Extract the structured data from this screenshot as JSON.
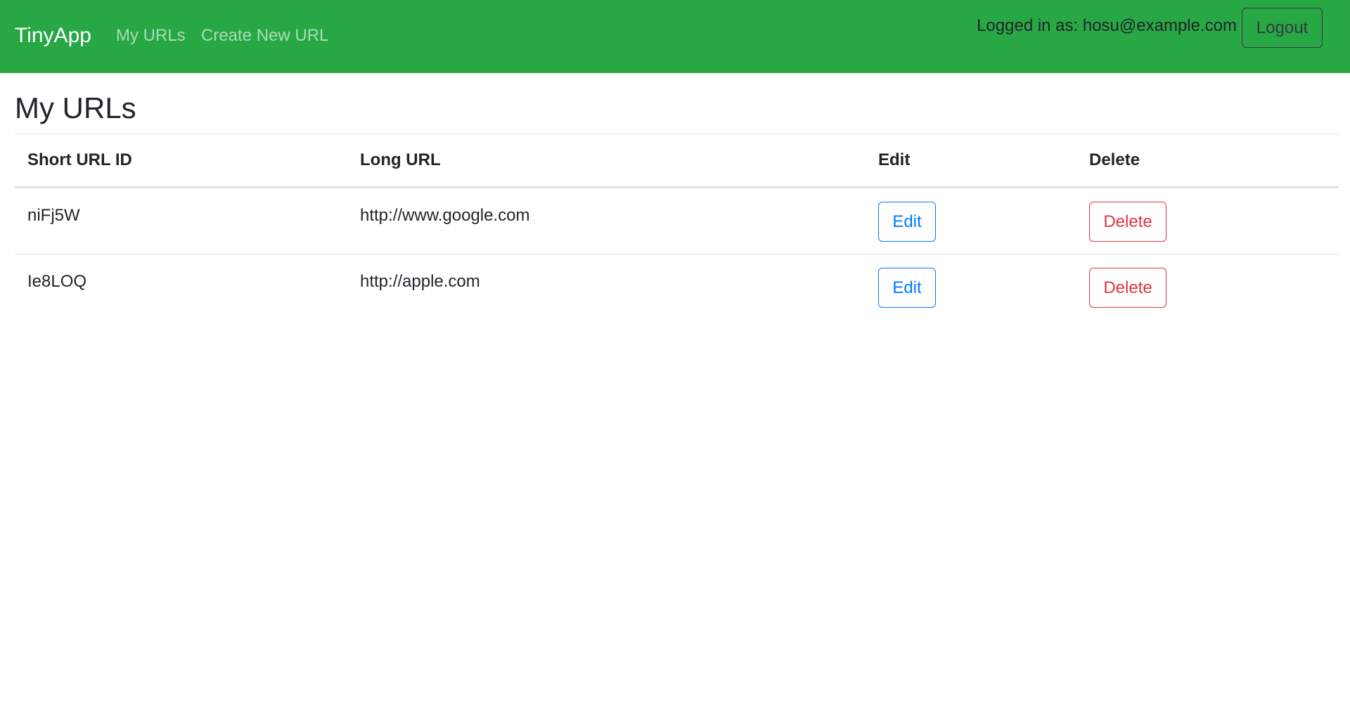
{
  "navbar": {
    "brand": "TinyApp",
    "links": [
      "My URLs",
      "Create New URL"
    ],
    "logged_in_text": "Logged in as: hosu@example.com",
    "logout_label": "Logout",
    "background_color": "#28a745"
  },
  "main": {
    "title": "My URLs",
    "table": {
      "headers": [
        "Short URL ID",
        "Long URL",
        "Edit",
        "Delete"
      ],
      "rows": [
        {
          "short_id": "niFj5W",
          "long_url": "http://www.google.com",
          "edit_label": "Edit",
          "delete_label": "Delete"
        },
        {
          "short_id": "Ie8LOQ",
          "long_url": "http://apple.com",
          "edit_label": "Edit",
          "delete_label": "Delete"
        }
      ]
    }
  },
  "colors": {
    "edit": "#007bff",
    "delete": "#dc3545"
  }
}
